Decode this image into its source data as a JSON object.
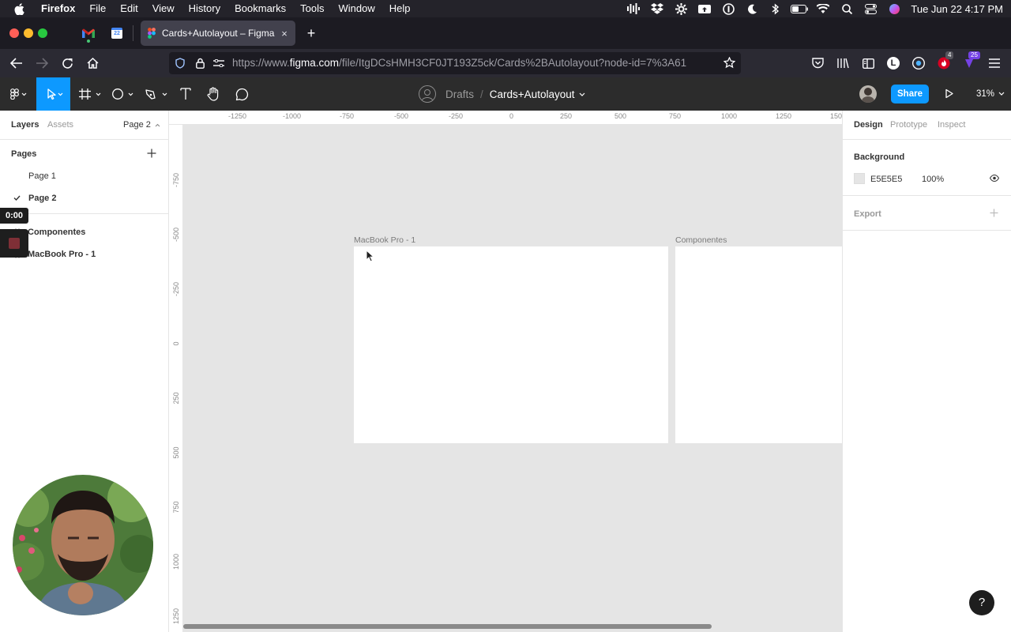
{
  "menubar": {
    "app": "Firefox",
    "items": [
      "File",
      "Edit",
      "View",
      "History",
      "Bookmarks",
      "Tools",
      "Window",
      "Help"
    ],
    "clock": "Tue Jun 22  4:17 PM"
  },
  "browser": {
    "active_tab_title": "Cards+Autolayout – Figma",
    "new_tab": "+",
    "tab_close": "×",
    "url_prefix": "https://www.",
    "url_domain": "figma.com",
    "url_path": "/file/ItgDCsHMH3CF0JT193Z5ck/Cards%2BAutolayout?node-id=7%3A61",
    "badge_4": "4",
    "badge_25": "25",
    "profile_letter": "L",
    "calendar_day": "22"
  },
  "figma_toolbar": {
    "breadcrumb_parent": "Drafts",
    "breadcrumb_sep": "/",
    "file_name": "Cards+Autolayout",
    "share_label": "Share",
    "zoom": "31%"
  },
  "left_panel": {
    "tabs": {
      "layers": "Layers",
      "assets": "Assets",
      "page_selector": "Page 2"
    },
    "pages_heading": "Pages",
    "pages": [
      "Page 1",
      "Page 2"
    ],
    "layers": [
      "Componentes",
      "MacBook Pro - 1"
    ]
  },
  "canvas": {
    "ruler_x": [
      "-1250",
      "-1000",
      "-750",
      "-500",
      "-250",
      "0",
      "250",
      "500",
      "750",
      "1000",
      "1250",
      "150"
    ],
    "ruler_y": [
      "-750",
      "-500",
      "-250",
      "0",
      "250",
      "500",
      "750",
      "1000",
      "1250"
    ],
    "frames": [
      "MacBook Pro - 1",
      "Componentes"
    ],
    "background_color": "#E5E5E5"
  },
  "right_panel": {
    "tabs": {
      "design": "Design",
      "prototype": "Prototype",
      "inspect": "Inspect"
    },
    "background_heading": "Background",
    "background_hex": "E5E5E5",
    "background_opacity": "100%",
    "export_heading": "Export"
  },
  "recording": {
    "time": "0:00"
  },
  "help": {
    "label": "?"
  },
  "colors": {
    "accent": "#0d99ff",
    "canvas": "#e5e5e5",
    "panel": "#ffffff",
    "toolbar": "#2c2c2c"
  }
}
